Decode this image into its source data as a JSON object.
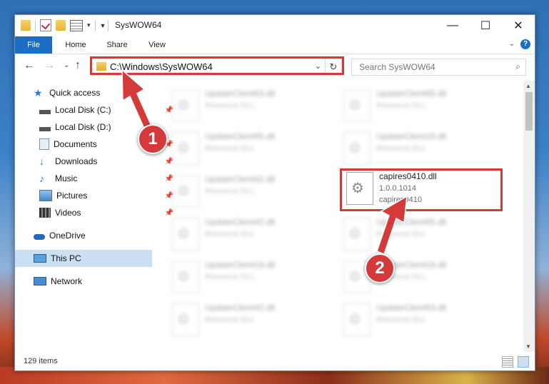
{
  "window": {
    "title": "SysWOW64",
    "controls": {
      "minimize": "—",
      "maximize": "☐",
      "close": "✕"
    }
  },
  "ribbon": {
    "tabs": [
      "File",
      "Home",
      "Share",
      "View"
    ],
    "help": "?"
  },
  "navigation": {
    "address_path": "C:\\Windows\\SysWOW64",
    "search_placeholder": "Search SysWOW64"
  },
  "sidebar": {
    "items": [
      {
        "label": "Quick access",
        "icon": "star-icon",
        "pinned": false
      },
      {
        "label": "Local Disk (C:)",
        "icon": "drive-icon",
        "pinned": true
      },
      {
        "label": "Local Disk (D:)",
        "icon": "drive-icon",
        "pinned": false
      },
      {
        "label": "Documents",
        "icon": "documents-icon",
        "pinned": true
      },
      {
        "label": "Downloads",
        "icon": "download-icon",
        "pinned": true
      },
      {
        "label": "Music",
        "icon": "music-icon",
        "pinned": true
      },
      {
        "label": "Pictures",
        "icon": "pictures-icon",
        "pinned": true
      },
      {
        "label": "Videos",
        "icon": "videos-icon",
        "pinned": true
      },
      {
        "label": "OneDrive",
        "icon": "cloud-icon",
        "pinned": false
      },
      {
        "label": "This PC",
        "icon": "computer-icon",
        "pinned": false,
        "selected": true
      },
      {
        "label": "Network",
        "icon": "network-icon",
        "pinned": false
      }
    ]
  },
  "files": [
    {
      "name": "UpdateClient63.dll",
      "line2": "Resource DLL",
      "line3": "",
      "blurred": true
    },
    {
      "name": "UpdateClient65.dll",
      "line2": "Resource DLL",
      "line3": "",
      "blurred": true
    },
    {
      "name": "UpdateClient65.dll",
      "line2": "Resource DLL",
      "line3": "",
      "blurred": true
    },
    {
      "name": "UpdateClient19.dll",
      "line2": "Resource DLL",
      "line3": "",
      "blurred": true
    },
    {
      "name": "UpdateClient42.dll",
      "line2": "Resource DLL",
      "line3": "",
      "blurred": true
    },
    {
      "name": "capires0410.dll",
      "line2": "1.0.0.1014",
      "line3": "capires0410",
      "blurred": false
    },
    {
      "name": "UpdateClient42.dll",
      "line2": "Resource DLL",
      "line3": "",
      "blurred": true
    },
    {
      "name": "UpdateClient65.dll",
      "line2": "Resource DLL",
      "line3": "",
      "blurred": true
    },
    {
      "name": "UpdateClient19.dll",
      "line2": "Resource DLL",
      "line3": "",
      "blurred": true
    },
    {
      "name": "UpdateClient19.dll",
      "line2": "Resource DLL",
      "line3": "",
      "blurred": true
    },
    {
      "name": "UpdateClient42.dll",
      "line2": "Resource DLL",
      "line3": "",
      "blurred": true
    },
    {
      "name": "UpdateClient63.dll",
      "line2": "Resource DLL",
      "line3": "",
      "blurred": true
    }
  ],
  "status": {
    "item_count": "129 items"
  },
  "annotations": {
    "step1": "1",
    "step2": "2",
    "color": "#d53a3a"
  }
}
